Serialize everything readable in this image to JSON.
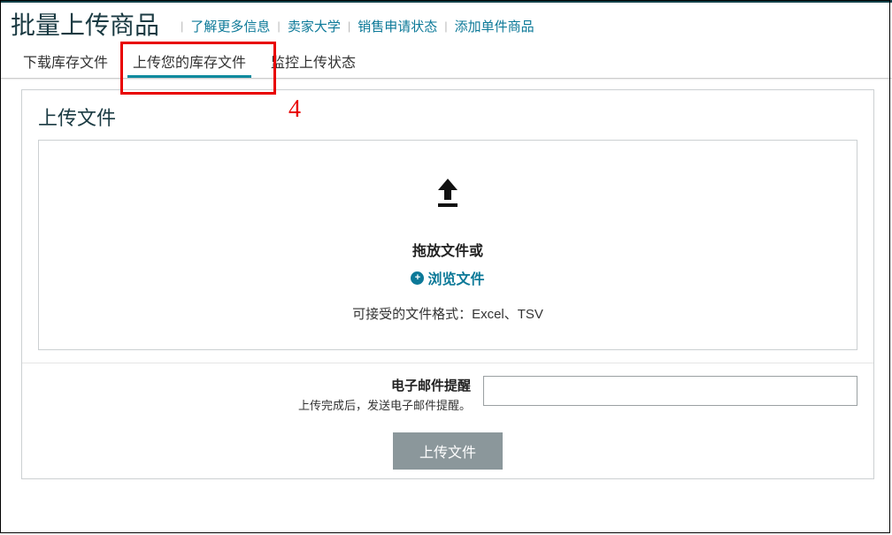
{
  "header": {
    "page_title": "批量上传商品",
    "links": [
      "了解更多信息",
      "卖家大学",
      "销售申请状态",
      "添加单件商品"
    ]
  },
  "tabs": {
    "download": "下载库存文件",
    "upload": "上传您的库存文件",
    "monitor": "监控上传状态"
  },
  "annotation": {
    "number": "4"
  },
  "card": {
    "title": "上传文件",
    "drop_text": "拖放文件或",
    "browse_text": "浏览文件",
    "formats": "可接受的文件格式：Excel、TSV",
    "email_label": "电子邮件提醒",
    "email_hint": "上传完成后，发送电子邮件提醒。",
    "submit_btn": "上传文件"
  }
}
